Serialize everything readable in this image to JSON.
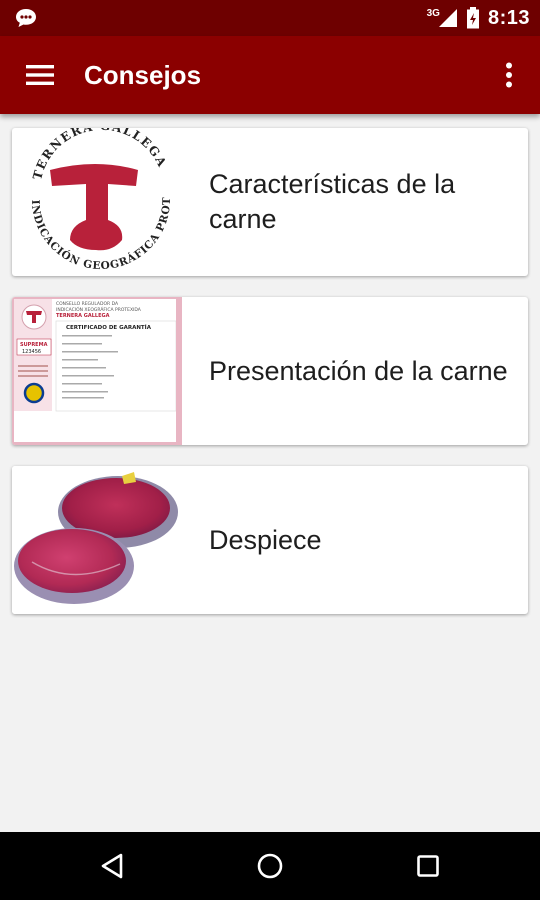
{
  "status_bar": {
    "time": "8:13",
    "network": "3G",
    "icons": [
      "notification-icon",
      "signal-icon",
      "battery-icon"
    ]
  },
  "app_bar": {
    "title": "Consejos",
    "menu_icon": "hamburger-menu-icon",
    "overflow_icon": "more-vert-icon",
    "color": "#8b0000"
  },
  "cards": [
    {
      "label": "Características de la carne",
      "image": "ternera-gallega-logo",
      "logo_text_top": "TERNERA GALLEGA",
      "logo_text_left": "INDICACIÓN",
      "logo_text_bottom": "GEOGRÁFICA",
      "logo_text_right": "PROTEGIDA"
    },
    {
      "label": "Presentación de la carne",
      "image": "certificado-de-garantia",
      "cert_header_1": "CONSELLO REGULADOR DA",
      "cert_header_2": "INDICACIÓN XEOGRÁFICA PROTEXIDA",
      "cert_brand": "TERNERA GALLEGA",
      "cert_title": "CERTIFICADO DE GARANTÍA",
      "cert_grade": "SUPREMA",
      "cert_number": "123456"
    },
    {
      "label": "Despiece",
      "image": "meat-cut-photo"
    }
  ],
  "nav_bar": {
    "back_icon": "back-icon",
    "home_icon": "home-icon",
    "recents_icon": "recents-icon"
  }
}
